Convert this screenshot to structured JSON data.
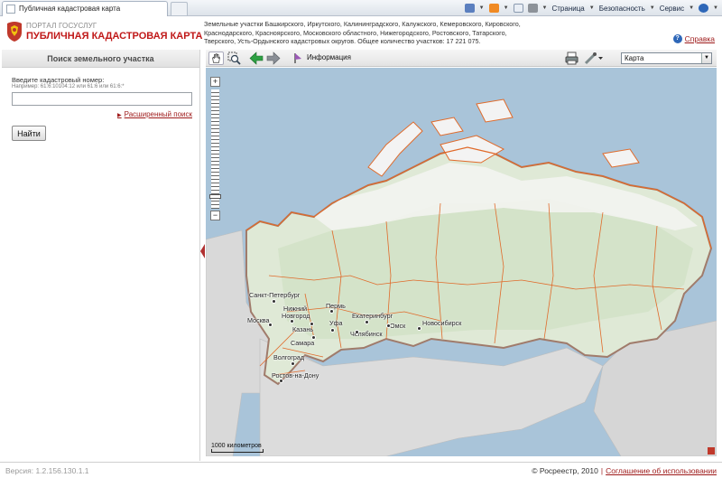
{
  "browser": {
    "tab_title": "Публичная кадастровая карта",
    "commands": {
      "page": "Страница",
      "safety": "Безопасность",
      "tools": "Сервис"
    }
  },
  "header": {
    "portal": "ПОРТАЛ ГОСУСЛУГ",
    "title": "ПУБЛИЧНАЯ КАДАСТРОВАЯ КАРТА",
    "info_line1": "Земельные участки Башкирского, Иркутского, Калининградского, Калужского, Кемеровского, Кировского,",
    "info_line2": "Краснодарского, Красноярского, Московского областного, Нижегородского, Ростовского, Татарского,",
    "info_line3": "Тверского, Усть-Ордынского кадастровых округов. Общее количество участков: 17 221 075.",
    "help": "Справка"
  },
  "search": {
    "heading": "Поиск земельного участка",
    "label": "Введите кадастровый номер:",
    "hint": "Например: 61:6:10104:12 или 61:6 или 61:6:*",
    "value": "",
    "advanced": "Расширенный поиск",
    "find_button": "Найти"
  },
  "toolbar": {
    "info_label": "Информация",
    "layer_value": "Карта"
  },
  "map": {
    "scale_label": "1000 километров",
    "cities": [
      {
        "name": "Санкт-Петербург"
      },
      {
        "name": "Нижний"
      },
      {
        "name": "Новгород"
      },
      {
        "name": "Пермь"
      },
      {
        "name": "Москва"
      },
      {
        "name": "Казань"
      },
      {
        "name": "Уфа"
      },
      {
        "name": "Екатеринбург"
      },
      {
        "name": "Омск"
      },
      {
        "name": "Новосибирск"
      },
      {
        "name": "Челябинск"
      },
      {
        "name": "Самара"
      },
      {
        "name": "Волгоград"
      },
      {
        "name": "Ростов-на-Дону"
      }
    ],
    "colors": {
      "sea": "#a9c4d9",
      "land": "#dfe9d6",
      "border": "#e06a2a",
      "outside": "#dcdcdc"
    }
  },
  "footer": {
    "version": "Версия: 1.2.156.130.1.1",
    "copyright": "© Росреестр, 2010",
    "agreement": "Соглашение об использовании"
  }
}
